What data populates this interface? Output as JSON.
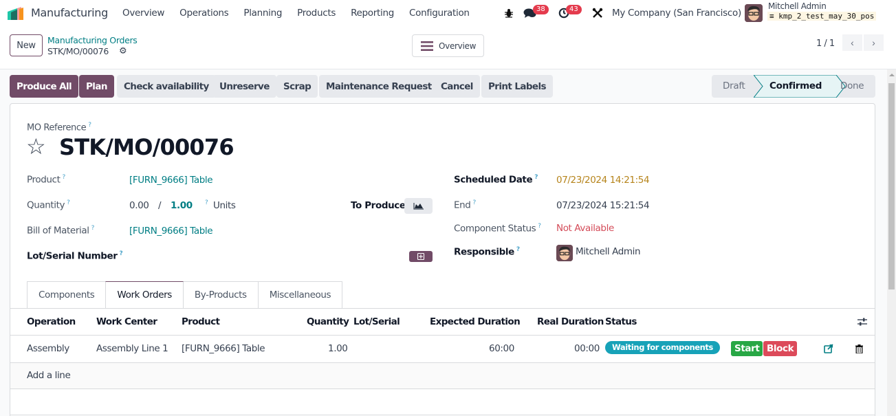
{
  "navbar": {
    "app_name": "Manufacturing",
    "menu": [
      "Overview",
      "Operations",
      "Planning",
      "Products",
      "Reporting",
      "Configuration"
    ],
    "icons": {
      "debug": "bug-icon",
      "messages": "chat-icon",
      "activities": "clock-icon",
      "settings": "tools-icon"
    },
    "messages_count": "38",
    "activities_count": "43",
    "company": "My Company (San Francisco)",
    "user_name": "Mitchell Admin",
    "database": "kmp_2_test_may_30_pos"
  },
  "control_panel": {
    "new_label": "New",
    "breadcrumb_parent": "Manufacturing Orders",
    "breadcrumb_current": "STK/MO/00076",
    "overview_label": "Overview",
    "pager_value": "1 / 1",
    "prev_glyph": "‹",
    "next_glyph": "›"
  },
  "actions": {
    "buttons": [
      "Produce All",
      "Plan",
      "Check availability",
      "Unreserve",
      "Scrap",
      "Maintenance Request",
      "Cancel",
      "Print Labels"
    ],
    "statuses": [
      "Draft",
      "Confirmed",
      "Done"
    ],
    "current_status": "Confirmed"
  },
  "form": {
    "ref_label": "MO Reference",
    "ref_value": "STK/MO/00076",
    "help_mark": "?",
    "product_label": "Product",
    "product_value": "[FURN_9666] Table",
    "quantity_label": "Quantity",
    "qty_produced": "0.00",
    "qty_separator": "/",
    "qty_to_produce": "1.00",
    "qty_uom": "Units",
    "to_produce_label": "To Produce",
    "bom_label": "Bill of Material",
    "bom_value": "[FURN_9666] Table",
    "lot_label": "Lot/Serial Number",
    "scheduled_label": "Scheduled Date",
    "scheduled_value": "07/23/2024 14:21:54",
    "end_label": "End",
    "end_value": "07/23/2024 15:21:54",
    "component_status_label": "Component Status",
    "component_status_value": "Not Available",
    "responsible_label": "Responsible",
    "responsible_value": "Mitchell Admin"
  },
  "tabs": [
    "Components",
    "Work Orders",
    "By-Products",
    "Miscellaneous"
  ],
  "active_tab": "Work Orders",
  "work_orders": {
    "columns": [
      "Operation",
      "Work Center",
      "Product",
      "Quantity",
      "Lot/Serial",
      "Expected Duration",
      "Real Duration",
      "Status"
    ],
    "rows": [
      {
        "operation": "Assembly",
        "work_center": "Assembly Line 1",
        "product": "[FURN_9666] Table",
        "quantity": "1.00",
        "lot_serial": "",
        "expected_duration": "60:00",
        "real_duration": "00:00",
        "status": "Waiting for components",
        "start_label": "Start",
        "block_label": "Block"
      }
    ],
    "add_line_label": "Add a line"
  },
  "colors": {
    "brand": "#714b67",
    "link": "#017e84",
    "scheduled_date": "#b6841b",
    "not_available": "#d44c59",
    "status_pill": "#17a2b8",
    "start": "#28a745",
    "block": "#dc4a5a",
    "badge": "#e43b4d"
  }
}
